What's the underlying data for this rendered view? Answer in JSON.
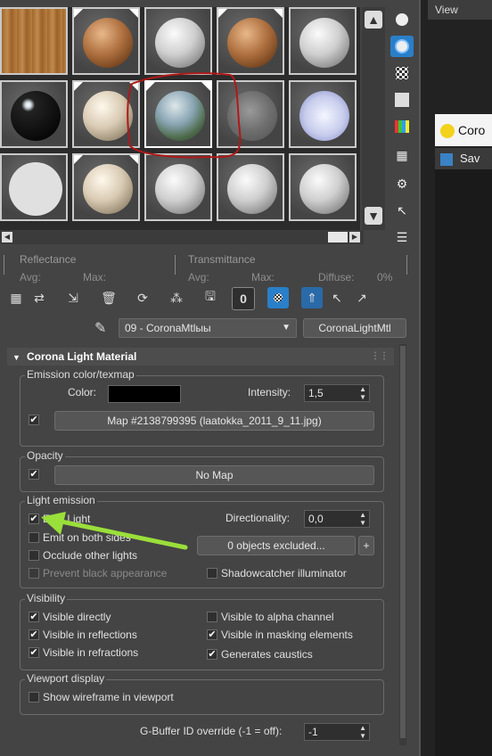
{
  "view_tab": "View",
  "corona_window_title": "Coro",
  "save_label": "Sav",
  "info": {
    "reflectance": "Reflectance",
    "transmittance": "Transmittance",
    "avg1": "Avg:",
    "max1": "Max:",
    "avg2": "Avg:",
    "max2": "Max:",
    "diffuse": "Diffuse:",
    "diffuse_value": "0%"
  },
  "toolbar": {
    "mtl_id": "0"
  },
  "material_name": "09 - CoronaMtlыы",
  "material_type": "CoronaLightMtl",
  "rollout_title": "Corona Light Material",
  "emission": {
    "group": "Emission color/texmap",
    "color_label": "Color:",
    "color_value": "#000000",
    "intensity_label": "Intensity:",
    "intensity_value": "1,5",
    "map_button": "Map #2138799395 (laatokka_2011_9_11.jpg)"
  },
  "opacity": {
    "group": "Opacity",
    "map_button": "No Map"
  },
  "light_emission": {
    "group": "Light emission",
    "emit_light": "Emit Light",
    "emit_both": "Emit on both sides",
    "occlude": "Occlude other lights",
    "prevent_black": "Prevent black appearance",
    "directionality_label": "Directionality:",
    "directionality_value": "0,0",
    "excluded_button": "0 objects excluded...",
    "shadowcatcher": "Shadowcatcher illuminator"
  },
  "visibility": {
    "group": "Visibility",
    "directly": "Visible directly",
    "reflections": "Visible in reflections",
    "refractions": "Visible in refractions",
    "alpha": "Visible to alpha channel",
    "masking": "Visible in masking elements",
    "caustics": "Generates caustics"
  },
  "viewport": {
    "group": "Viewport display",
    "wireframe": "Show wireframe in viewport"
  },
  "gbuffer": {
    "label": "G-Buffer ID override (-1 = off):",
    "value": "-1"
  },
  "colors": {
    "annotation_red": "#b01818",
    "arrow_green": "#9adf3a",
    "accent_blue": "#2a7fc9"
  }
}
